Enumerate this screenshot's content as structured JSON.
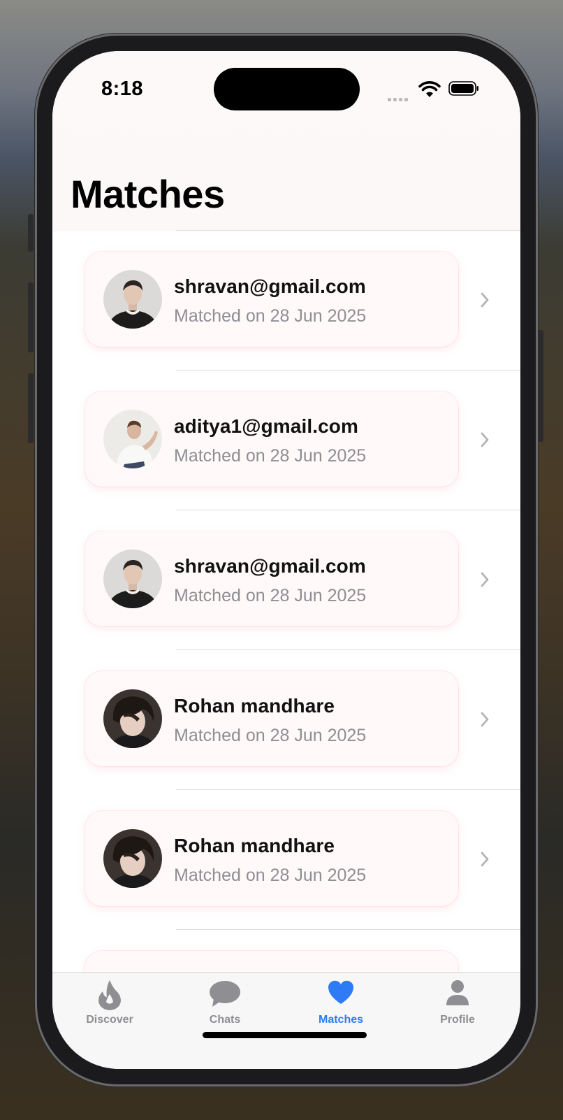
{
  "status_bar": {
    "time": "8:18"
  },
  "page": {
    "title": "Matches"
  },
  "matches": [
    {
      "name": "shravan@gmail.com",
      "subtitle": "Matched on 28 Jun 2025",
      "avatar": "person-dark-sweater"
    },
    {
      "name": "aditya1@gmail.com",
      "subtitle": "Matched on 28 Jun 2025",
      "avatar": "person-white-tshirt-seated"
    },
    {
      "name": "shravan@gmail.com",
      "subtitle": "Matched on 28 Jun 2025",
      "avatar": "person-dark-sweater"
    },
    {
      "name": "Rohan mandhare",
      "subtitle": "Matched on 28 Jun 2025",
      "avatar": "person-dark-hair"
    },
    {
      "name": "Rohan mandhare",
      "subtitle": "Matched on 28 Jun 2025",
      "avatar": "person-dark-hair"
    },
    {
      "name": "",
      "subtitle": "",
      "avatar": ""
    }
  ],
  "tabbar": {
    "items": [
      {
        "label": "Discover",
        "icon": "flame-icon"
      },
      {
        "label": "Chats",
        "icon": "chat-bubble-icon"
      },
      {
        "label": "Matches",
        "icon": "heart-icon",
        "active": true
      },
      {
        "label": "Profile",
        "icon": "person-icon"
      }
    ]
  },
  "colors": {
    "accent": "#2f7bf5",
    "card_bg": "#fff9fa",
    "subtitle": "#8e8e93"
  }
}
